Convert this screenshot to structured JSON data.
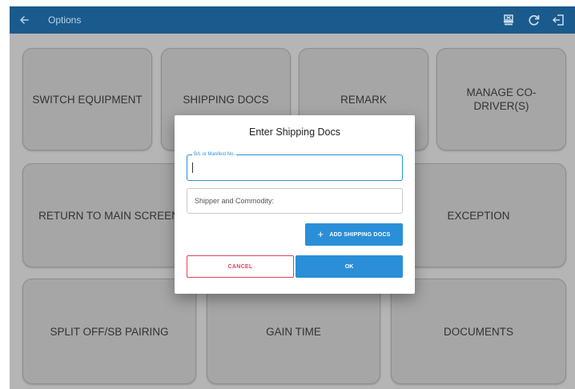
{
  "topbar": {
    "title": "Options",
    "icons": [
      "back-arrow-icon",
      "print-icon",
      "refresh-icon",
      "logout-icon"
    ],
    "color": "#1b5a8c"
  },
  "tiles": {
    "switch_equipment": "SWITCH EQUIPMENT",
    "shipping_docs": "SHIPPING DOCS",
    "remark": "REMARK",
    "manage_codriver": "MANAGE CO-DRIVER(S)",
    "return_main": "RETURN TO MAIN SCREEN",
    "exception": "EXCEPTION",
    "split_off": "SPLIT OFF/SB PAIRING",
    "gain_time": "GAIN TIME",
    "documents": "DOCUMENTS"
  },
  "dialog": {
    "title": "Enter Shipping Docs",
    "bl_field": {
      "label": "B/L or Manifest No.",
      "value": ""
    },
    "shipper_field": {
      "placeholder": "Shipper and Commodity:",
      "value": ""
    },
    "add_button": "ADD SHIPPING DOCS",
    "cancel_button": "CANCEL",
    "ok_button": "OK"
  },
  "colors": {
    "accent": "#2a8fd8",
    "cancel": "#e0435b",
    "tile": "#a6a6a6"
  }
}
